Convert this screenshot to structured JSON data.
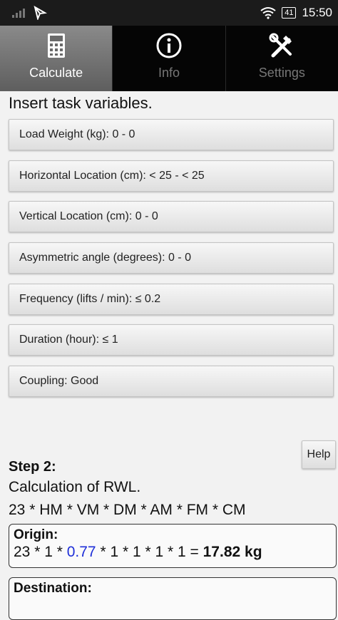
{
  "status_bar": {
    "time": "15:50",
    "battery": "41",
    "signal_icon": "signal-bars-icon",
    "notification_icon": "app-notification-icon",
    "wifi_icon": "wifi-icon"
  },
  "tabs": [
    {
      "label": "Calculate",
      "icon": "calculator-icon",
      "active": true
    },
    {
      "label": "Info",
      "icon": "info-icon",
      "active": false
    },
    {
      "label": "Settings",
      "icon": "tools-icon",
      "active": false
    }
  ],
  "instruction": "Insert task variables.",
  "variables": [
    "Load Weight (kg): 0 - 0",
    "Horizontal Location (cm): < 25 - < 25",
    "Vertical Location (cm): 0 - 0",
    "Asymmetric angle (degrees): 0 - 0",
    "Frequency (lifts / min): ≤ 0.2",
    "Duration (hour): ≤ 1",
    "Coupling: Good"
  ],
  "help_label": "Help",
  "step": {
    "title": "Step 2:",
    "description": "Calculation of RWL.",
    "formula": "23 * HM * VM * DM * AM * FM * CM"
  },
  "origin": {
    "title": "Origin:",
    "prefix": "23 * 1 * ",
    "highlight": "0.77",
    "suffix": " * 1 * 1 * 1 * 1 = ",
    "result": "17.82 kg"
  },
  "destination": {
    "title": "Destination:"
  },
  "colors": {
    "status_bar": "#1b1b1b",
    "tab_bar": "#050505",
    "tab_active": "#6e6e6e",
    "highlight": "#1e2fd8",
    "background": "#f2f2f2"
  }
}
